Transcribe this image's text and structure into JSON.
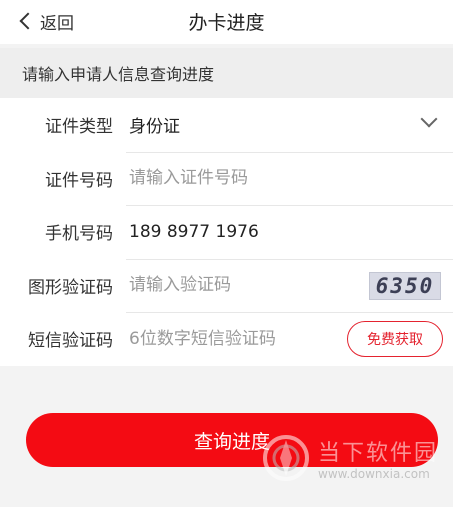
{
  "header": {
    "back_label": "返回",
    "title": "办卡进度"
  },
  "section_hint": "请输入申请人信息查询进度",
  "form": {
    "id_type": {
      "label": "证件类型",
      "value": "身份证"
    },
    "id_number": {
      "label": "证件号码",
      "placeholder": "请输入证件号码"
    },
    "phone": {
      "label": "手机号码",
      "value": "189 8977 1976"
    },
    "image_code": {
      "label": "图形验证码",
      "placeholder": "请输入验证码",
      "captcha_text": "6350"
    },
    "sms_code": {
      "label": "短信验证码",
      "placeholder": "6位数字短信验证码",
      "button_label": "免费获取"
    }
  },
  "submit_label": "查询进度",
  "watermark": {
    "name": "当下软件园",
    "url": "www.downxia.com"
  },
  "colors": {
    "accent": "#f40b13"
  }
}
